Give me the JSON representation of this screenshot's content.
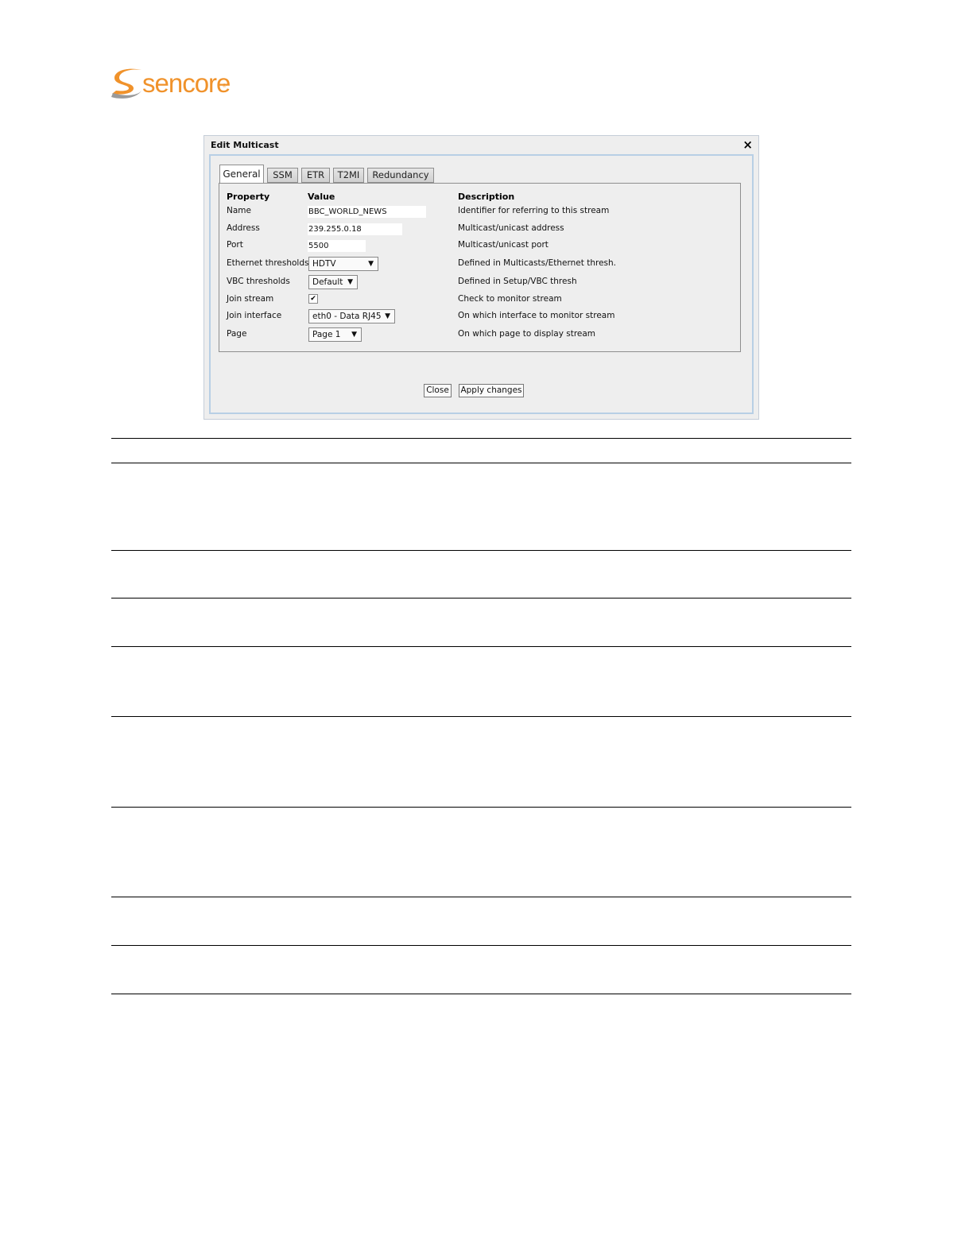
{
  "brand": {
    "name": "sencore",
    "trademark": "®",
    "color": "#f0922b"
  },
  "dialog": {
    "title": "Edit Multicast",
    "close_icon": "×",
    "tabs": [
      {
        "label": "General",
        "active": true
      },
      {
        "label": "SSM",
        "active": false
      },
      {
        "label": "ETR",
        "active": false
      },
      {
        "label": "T2MI",
        "active": false
      },
      {
        "label": "Redundancy",
        "active": false
      }
    ],
    "headers": {
      "property": "Property",
      "value": "Value",
      "description": "Description"
    },
    "rows": {
      "name": {
        "property": "Name",
        "value": "BBC_WORLD_NEWS",
        "description": "Identifier for referring to this stream"
      },
      "address": {
        "property": "Address",
        "value": "239.255.0.18",
        "description": "Multicast/unicast address"
      },
      "port": {
        "property": "Port",
        "value": "5500",
        "description": "Multicast/unicast port"
      },
      "ethernet_thresholds": {
        "property": "Ethernet thresholds",
        "value": "HDTV",
        "description": "Defined in Multicasts/Ethernet thresh."
      },
      "vbc_thresholds": {
        "property": "VBC thresholds",
        "value": "Default",
        "description": "Defined in Setup/VBC thresh"
      },
      "join_stream": {
        "property": "Join stream",
        "checked": true,
        "check_glyph": "✔",
        "description": "Check to monitor stream"
      },
      "join_interface": {
        "property": "Join interface",
        "value": "eth0 - Data RJ45",
        "description": "On which interface to monitor stream"
      },
      "page": {
        "property": "Page",
        "value": "Page 1",
        "description": "On which page to display stream"
      }
    },
    "dropdown_arrow": "▼",
    "buttons": {
      "close": "Close",
      "apply": "Apply changes"
    }
  }
}
